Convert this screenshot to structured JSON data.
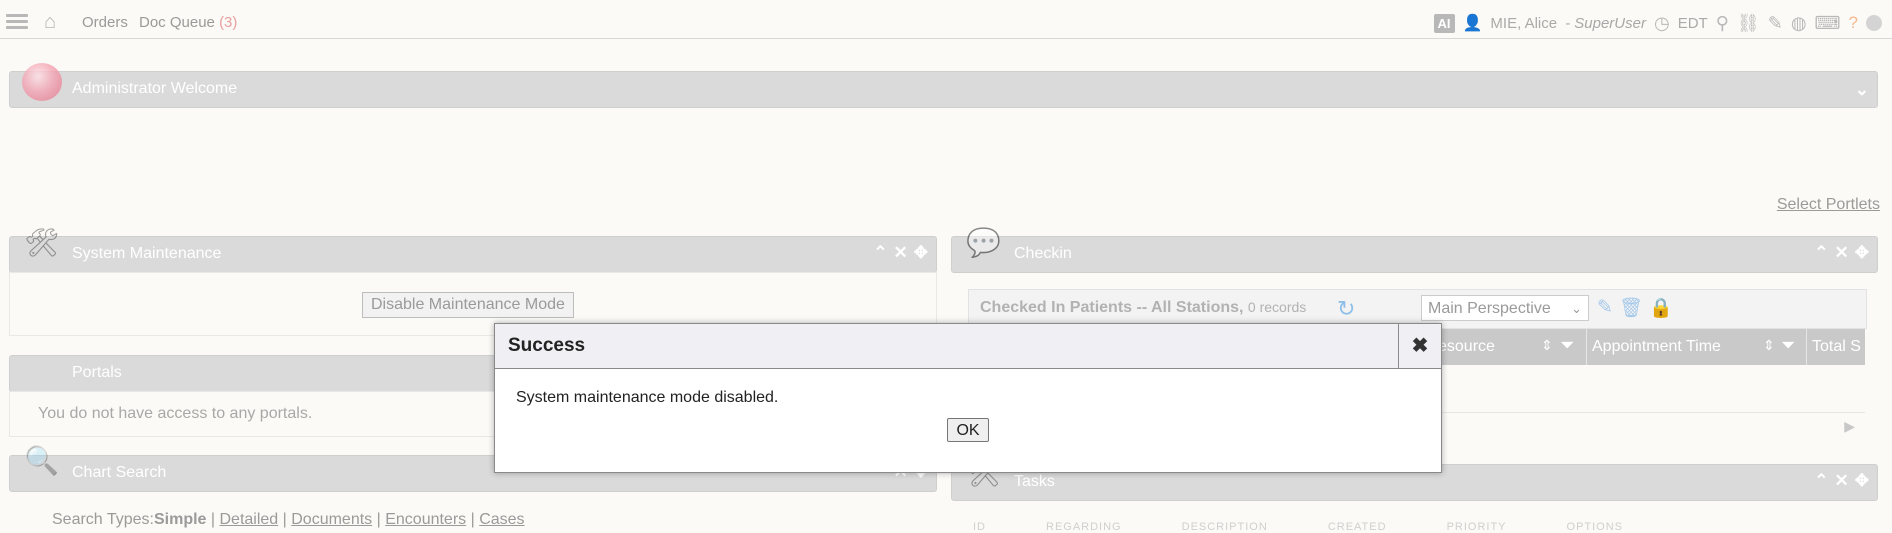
{
  "topbar": {
    "orders": "Orders",
    "doc_queue": "Doc Queue",
    "doc_queue_count": "(3)",
    "ai_badge": "AI",
    "user": "MIE, Alice",
    "role": "- SuperUser",
    "timezone": "EDT"
  },
  "icons": [
    "menu-icon",
    "home-icon",
    "user-icon",
    "clock-icon",
    "search-icon",
    "link-icon",
    "magic-wand-icon",
    "globe-icon",
    "keyboard-icon",
    "help-icon"
  ],
  "portlets": {
    "admin_welcome": "Administrator Welcome",
    "select_portlets": "Select Portlets",
    "system_maintenance": "System Maintenance",
    "disable_maintenance": "Disable Maintenance Mode",
    "portals": "Portals",
    "portals_msg": "You do not have access to any portals.",
    "chart_search": "Chart Search",
    "search_types_label": "Search Types:",
    "search_types": {
      "simple": "Simple",
      "detailed": "Detailed",
      "documents": "Documents",
      "encounters": "Encounters",
      "cases": "Cases"
    },
    "checkin": "Checkin",
    "tasks": "Tasks"
  },
  "checkin": {
    "title": "Checked In Patients -- All Stations,",
    "records": "0 records",
    "perspective": "Main Perspective",
    "columns": {
      "resource": "esource",
      "appointment_time": "Appointment Time",
      "total": "Total S"
    }
  },
  "tasks_columns": [
    "ID",
    "REGARDING",
    "DESCRIPTION",
    "CREATED",
    "PRIORITY",
    "OPTIONS"
  ],
  "modal": {
    "title": "Success",
    "message": "System maintenance mode disabled.",
    "ok_label": "OK",
    "close_glyph": "✖"
  }
}
